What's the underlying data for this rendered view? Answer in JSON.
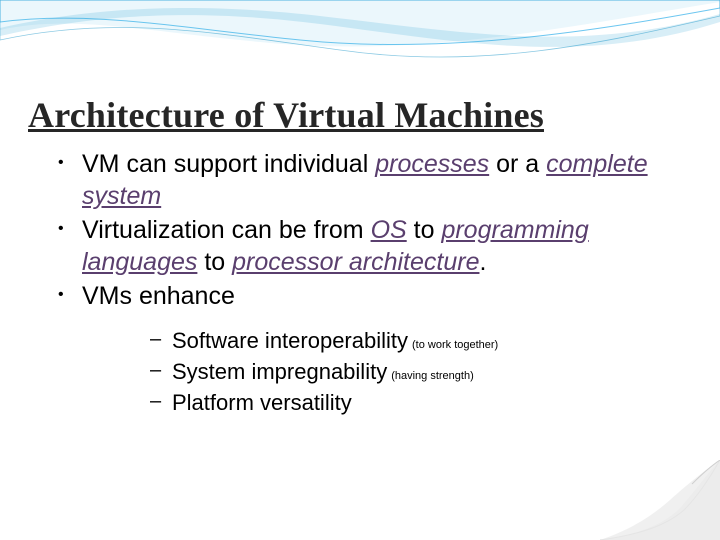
{
  "title": "Architecture of Virtual Machines",
  "bullets": {
    "b1_pre": "VM can support individual ",
    "b1_em1": "processes",
    "b1_mid": " or a ",
    "b1_em2": "complete system",
    "b2_pre": "Virtualization can be from ",
    "b2_em1": "OS",
    "b2_mid1": " to ",
    "b2_em2": "programming languages",
    "b2_mid2": " to ",
    "b2_em3": "processor architecture",
    "b2_post": ".",
    "b3": "VMs enhance"
  },
  "sub": {
    "s1_text": "Software interoperability",
    "s1_note": "(to work together)",
    "s2_text": "System impregnability",
    "s2_note": "(having strength)",
    "s3_text": "Platform versatility"
  }
}
